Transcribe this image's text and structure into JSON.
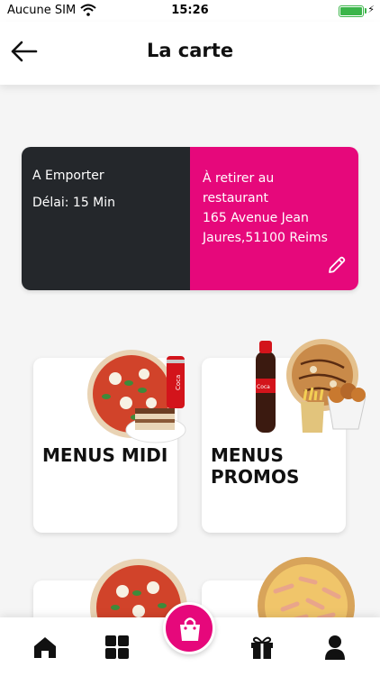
{
  "status_bar": {
    "carrier": "Aucune SIM",
    "time": "15:26",
    "wifi_icon": "wifi-icon",
    "battery_icon": "battery-full-icon",
    "charging_icon": "bolt-icon"
  },
  "header": {
    "title": "La carte",
    "back_icon": "arrow-left-icon"
  },
  "order": {
    "mode": "A Emporter",
    "delay": "Délai: 15 Min",
    "pickup_line1": "À retirer au",
    "pickup_line2": "restaurant",
    "address_line1": "165 Avenue Jean",
    "address_line2": "Jaures,51100 Reims",
    "edit_icon": "pencil-icon",
    "colors": {
      "dark": "#24272b",
      "accent": "#e6087b"
    }
  },
  "menus": [
    {
      "line1": "MENUS MIDI",
      "line2": "",
      "image": "pizza-tiramisu-coke-image"
    },
    {
      "line1": "MENUS",
      "line2": "PROMOS",
      "image": "pizza-chicken-fries-coke-image"
    },
    {
      "line1": "",
      "line2": "",
      "image": "margherita-pizza-image"
    },
    {
      "line1": "",
      "line2": "",
      "image": "ham-pizza-image"
    }
  ],
  "bottom_nav": [
    {
      "icon": "home-icon"
    },
    {
      "icon": "grid-icon"
    },
    {
      "icon": "shopping-bag-icon"
    },
    {
      "icon": "gift-icon"
    },
    {
      "icon": "user-icon"
    }
  ]
}
